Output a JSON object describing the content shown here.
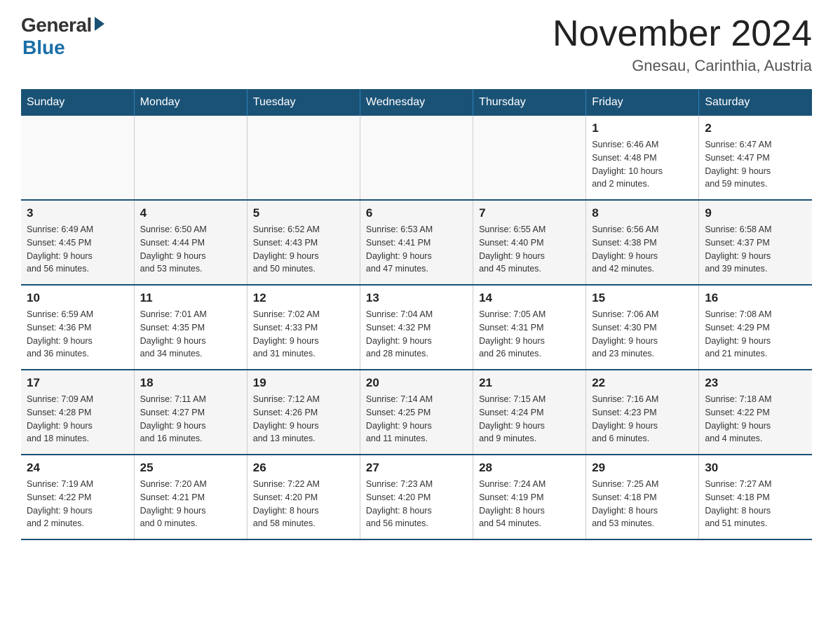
{
  "header": {
    "logo_general": "General",
    "logo_blue": "Blue",
    "month_title": "November 2024",
    "location": "Gnesau, Carinthia, Austria"
  },
  "weekdays": [
    "Sunday",
    "Monday",
    "Tuesday",
    "Wednesday",
    "Thursday",
    "Friday",
    "Saturday"
  ],
  "weeks": [
    [
      {
        "day": "",
        "info": ""
      },
      {
        "day": "",
        "info": ""
      },
      {
        "day": "",
        "info": ""
      },
      {
        "day": "",
        "info": ""
      },
      {
        "day": "",
        "info": ""
      },
      {
        "day": "1",
        "info": "Sunrise: 6:46 AM\nSunset: 4:48 PM\nDaylight: 10 hours\nand 2 minutes."
      },
      {
        "day": "2",
        "info": "Sunrise: 6:47 AM\nSunset: 4:47 PM\nDaylight: 9 hours\nand 59 minutes."
      }
    ],
    [
      {
        "day": "3",
        "info": "Sunrise: 6:49 AM\nSunset: 4:45 PM\nDaylight: 9 hours\nand 56 minutes."
      },
      {
        "day": "4",
        "info": "Sunrise: 6:50 AM\nSunset: 4:44 PM\nDaylight: 9 hours\nand 53 minutes."
      },
      {
        "day": "5",
        "info": "Sunrise: 6:52 AM\nSunset: 4:43 PM\nDaylight: 9 hours\nand 50 minutes."
      },
      {
        "day": "6",
        "info": "Sunrise: 6:53 AM\nSunset: 4:41 PM\nDaylight: 9 hours\nand 47 minutes."
      },
      {
        "day": "7",
        "info": "Sunrise: 6:55 AM\nSunset: 4:40 PM\nDaylight: 9 hours\nand 45 minutes."
      },
      {
        "day": "8",
        "info": "Sunrise: 6:56 AM\nSunset: 4:38 PM\nDaylight: 9 hours\nand 42 minutes."
      },
      {
        "day": "9",
        "info": "Sunrise: 6:58 AM\nSunset: 4:37 PM\nDaylight: 9 hours\nand 39 minutes."
      }
    ],
    [
      {
        "day": "10",
        "info": "Sunrise: 6:59 AM\nSunset: 4:36 PM\nDaylight: 9 hours\nand 36 minutes."
      },
      {
        "day": "11",
        "info": "Sunrise: 7:01 AM\nSunset: 4:35 PM\nDaylight: 9 hours\nand 34 minutes."
      },
      {
        "day": "12",
        "info": "Sunrise: 7:02 AM\nSunset: 4:33 PM\nDaylight: 9 hours\nand 31 minutes."
      },
      {
        "day": "13",
        "info": "Sunrise: 7:04 AM\nSunset: 4:32 PM\nDaylight: 9 hours\nand 28 minutes."
      },
      {
        "day": "14",
        "info": "Sunrise: 7:05 AM\nSunset: 4:31 PM\nDaylight: 9 hours\nand 26 minutes."
      },
      {
        "day": "15",
        "info": "Sunrise: 7:06 AM\nSunset: 4:30 PM\nDaylight: 9 hours\nand 23 minutes."
      },
      {
        "day": "16",
        "info": "Sunrise: 7:08 AM\nSunset: 4:29 PM\nDaylight: 9 hours\nand 21 minutes."
      }
    ],
    [
      {
        "day": "17",
        "info": "Sunrise: 7:09 AM\nSunset: 4:28 PM\nDaylight: 9 hours\nand 18 minutes."
      },
      {
        "day": "18",
        "info": "Sunrise: 7:11 AM\nSunset: 4:27 PM\nDaylight: 9 hours\nand 16 minutes."
      },
      {
        "day": "19",
        "info": "Sunrise: 7:12 AM\nSunset: 4:26 PM\nDaylight: 9 hours\nand 13 minutes."
      },
      {
        "day": "20",
        "info": "Sunrise: 7:14 AM\nSunset: 4:25 PM\nDaylight: 9 hours\nand 11 minutes."
      },
      {
        "day": "21",
        "info": "Sunrise: 7:15 AM\nSunset: 4:24 PM\nDaylight: 9 hours\nand 9 minutes."
      },
      {
        "day": "22",
        "info": "Sunrise: 7:16 AM\nSunset: 4:23 PM\nDaylight: 9 hours\nand 6 minutes."
      },
      {
        "day": "23",
        "info": "Sunrise: 7:18 AM\nSunset: 4:22 PM\nDaylight: 9 hours\nand 4 minutes."
      }
    ],
    [
      {
        "day": "24",
        "info": "Sunrise: 7:19 AM\nSunset: 4:22 PM\nDaylight: 9 hours\nand 2 minutes."
      },
      {
        "day": "25",
        "info": "Sunrise: 7:20 AM\nSunset: 4:21 PM\nDaylight: 9 hours\nand 0 minutes."
      },
      {
        "day": "26",
        "info": "Sunrise: 7:22 AM\nSunset: 4:20 PM\nDaylight: 8 hours\nand 58 minutes."
      },
      {
        "day": "27",
        "info": "Sunrise: 7:23 AM\nSunset: 4:20 PM\nDaylight: 8 hours\nand 56 minutes."
      },
      {
        "day": "28",
        "info": "Sunrise: 7:24 AM\nSunset: 4:19 PM\nDaylight: 8 hours\nand 54 minutes."
      },
      {
        "day": "29",
        "info": "Sunrise: 7:25 AM\nSunset: 4:18 PM\nDaylight: 8 hours\nand 53 minutes."
      },
      {
        "day": "30",
        "info": "Sunrise: 7:27 AM\nSunset: 4:18 PM\nDaylight: 8 hours\nand 51 minutes."
      }
    ]
  ]
}
